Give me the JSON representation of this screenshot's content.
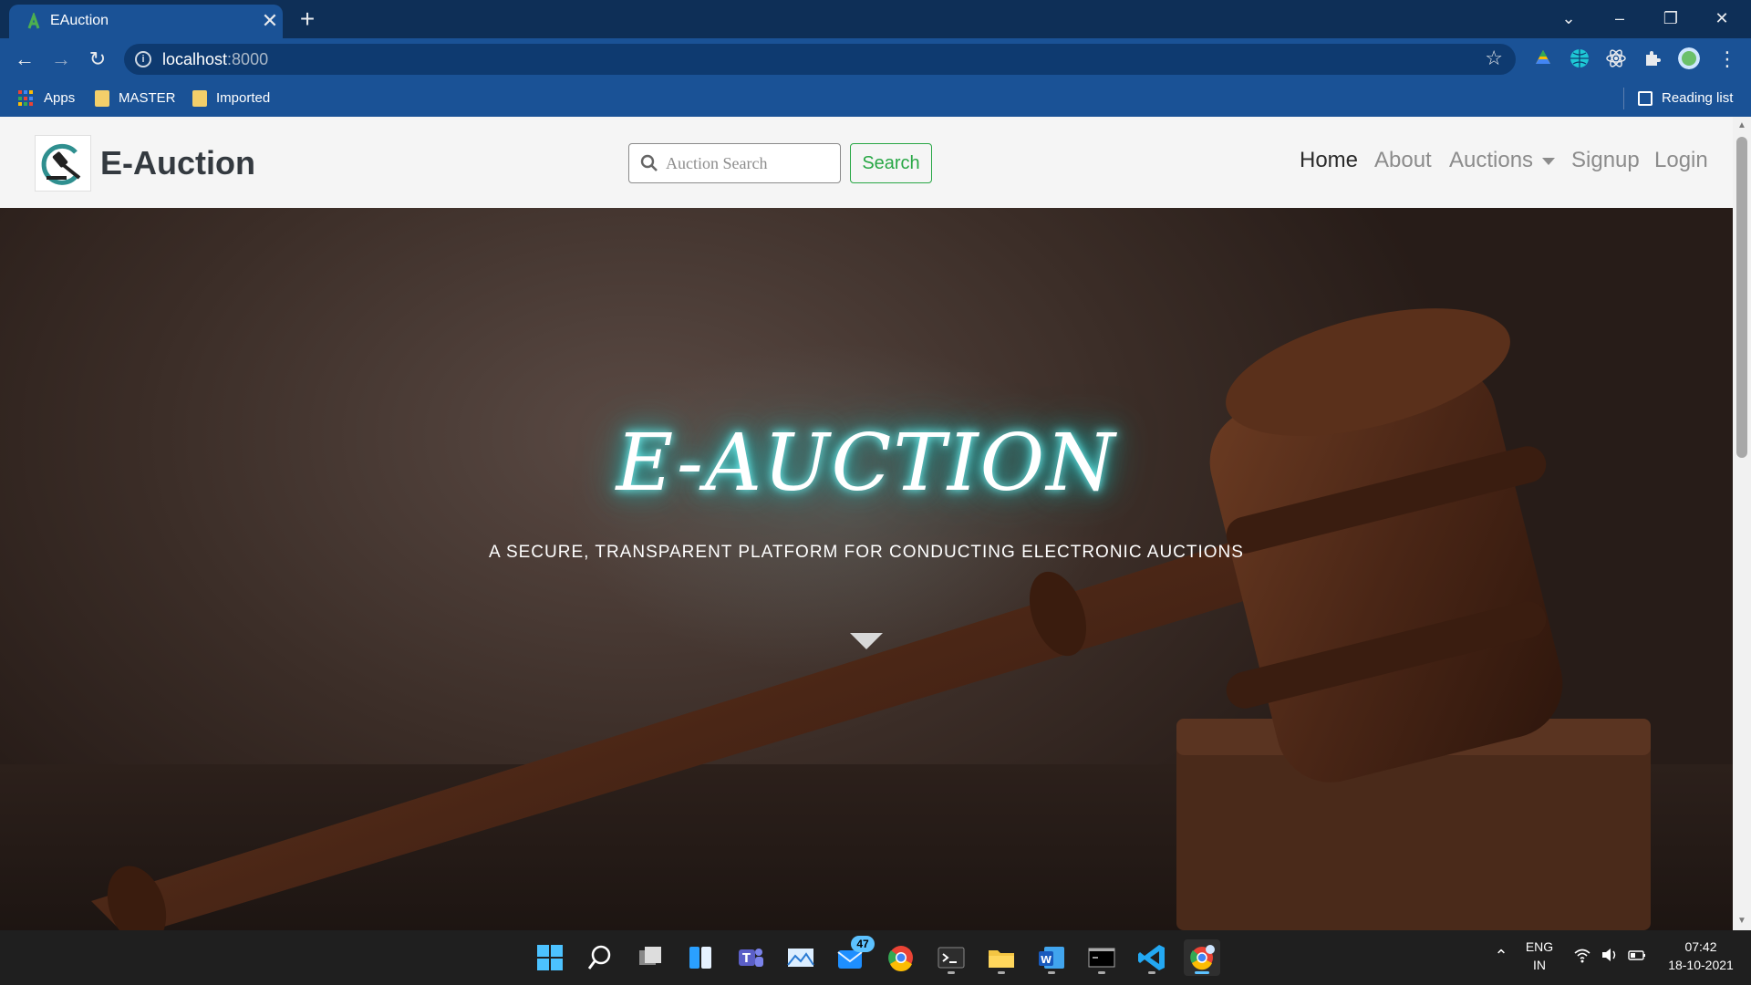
{
  "browser": {
    "tab_title": "EAuction",
    "url_host": "localhost",
    "url_port": ":8000",
    "bookmarks": [
      {
        "label": "Apps",
        "icon": "apps-grid-icon"
      },
      {
        "label": "MASTER",
        "icon": "folder-icon"
      },
      {
        "label": "Imported",
        "icon": "folder-icon"
      }
    ],
    "reading_list": "Reading list"
  },
  "navbar": {
    "brand": "E-Auction",
    "search_placeholder": "Auction Search",
    "search_button": "Search",
    "links": [
      "Home",
      "About",
      "Auctions",
      "Signup",
      "Login"
    ],
    "active_link": "Home"
  },
  "hero": {
    "title": "E-AUCTION",
    "subtitle": "A SECURE, TRANSPARENT PLATFORM FOR CONDUCTING ELECTRONIC AUCTIONS"
  },
  "taskbar": {
    "mail_badge": "47",
    "lang_top": "ENG",
    "lang_bottom": "IN",
    "time": "07:42",
    "date": "18-10-2021"
  },
  "colors": {
    "chrome_dark": "#0e2f57",
    "chrome_toolbar": "#1a5296",
    "search_green": "#28a745",
    "title_glow": "#22cccc"
  }
}
